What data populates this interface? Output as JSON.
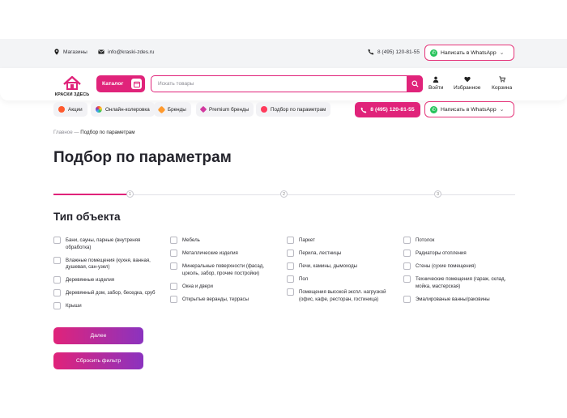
{
  "topbar": {
    "shops": "Магазины",
    "email": "info@kraski-zdes.ru",
    "phone": "8 (495) 120-81-55",
    "whatsapp": "Написать в WhatsApp"
  },
  "header": {
    "logo_text": "КРАСКИ ЗДЕСЬ",
    "catalog_label": "Каталог",
    "search_placeholder": "Искать товары",
    "actions": [
      {
        "label": "Войти",
        "icon": "user-icon"
      },
      {
        "label": "Избранное",
        "icon": "heart-icon"
      },
      {
        "label": "Корзина",
        "icon": "cart-icon"
      }
    ]
  },
  "nav": {
    "chips": [
      {
        "label": "Акции",
        "icon": "fire-icon",
        "color": "#ff5a2e"
      },
      {
        "label": "Онлайн-колеровка",
        "icon": "palette-icon",
        "color": "#3fa9f5"
      },
      {
        "label": "Бренды",
        "icon": "tag-icon",
        "color": "#ff9a2e"
      },
      {
        "label": "Premium бренды",
        "icon": "diamond-icon",
        "color": "#d23aa0"
      },
      {
        "label": "Подбор по параметрам",
        "icon": "picker-icon",
        "color": "#ff3b5c"
      }
    ],
    "phone": "8 (495) 120-81-55",
    "whatsapp": "Написать в WhatsApp"
  },
  "breadcrumb": {
    "home": "Главное",
    "sep": "—",
    "current": "Подбор по параметрам"
  },
  "page_title": "Подбор по параметрам",
  "steps": [
    "1",
    "2",
    "3"
  ],
  "section_title": "Тип объекта",
  "columns": [
    [
      "Бани, сауны, парные (внутреняя обработка)",
      "Влажные помещения (кухня, ванная, душевая, сан-узел)",
      "Деревянные изделия",
      "Деревянный дом, забор, беседка, сруб",
      "Крыши"
    ],
    [
      "Мебель",
      "Металлические изделия",
      "Минеральные поверхности (фасад, цоколь, забор, прочие постройки)",
      "Окна и двери",
      "Открытые веранды, террасы"
    ],
    [
      "Паркет",
      "Перила, лестницы",
      "Печи, камины, дымоходы",
      "Пол",
      "Помещения высокой экспл. нагрузкой (офис, кафе, ресторан, гостиница)"
    ],
    [
      "Потолок",
      "Радиаторы отопления",
      "Стены (сухие помещения)",
      "Технические помещения (гараж, склад, мойка, мастерская)",
      "Эмалированые ванны/раковины"
    ]
  ],
  "buttons": {
    "next": "Далее",
    "reset": "Сбросить фильтр"
  },
  "colors": {
    "accent": "#e0237a",
    "gradient_end": "#8b33bf",
    "whatsapp": "#25c35a"
  }
}
